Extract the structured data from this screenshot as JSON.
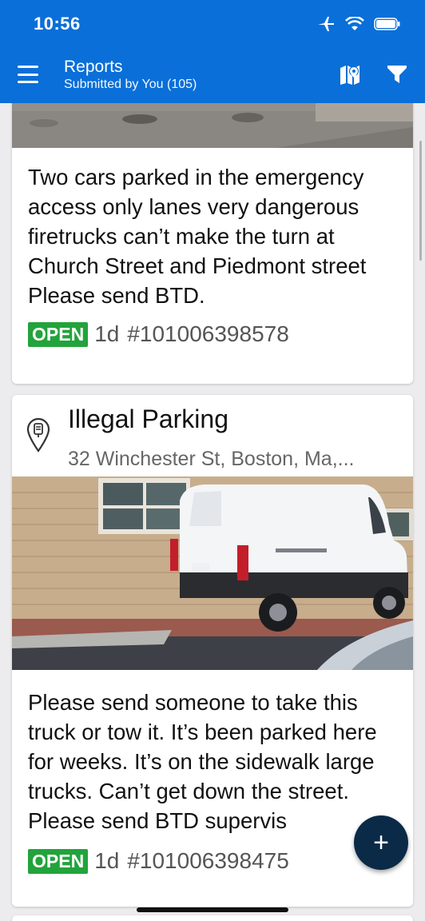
{
  "status_bar": {
    "time": "10:56"
  },
  "header": {
    "title": "Reports",
    "subtitle": "Submitted by You (105)",
    "icons": [
      "menu-icon",
      "map-pin-icon",
      "filter-icon"
    ],
    "color": "#0a6fd8"
  },
  "reports": [
    {
      "description": "Two cars parked in the emergency access only lanes very dangerous firetrucks can’t make the turn at Church Street and Piedmont street Please send BTD.",
      "status": "OPEN",
      "age": "1d",
      "id": "#101006398578"
    },
    {
      "title": "Illegal Parking",
      "address": "32 Winchester St, Boston, Ma,...",
      "description": "Please send someone to take this truck or tow it. It’s been parked here for weeks. It’s on the sidewalk large trucks. Can’t get down the street. Please send BTD supervis",
      "status": "OPEN",
      "age": "1d",
      "id": "#101006398475"
    }
  ],
  "fab": {
    "label": "+"
  },
  "colors": {
    "open_badge": "#22a33b",
    "fab": "#0b2a48"
  }
}
